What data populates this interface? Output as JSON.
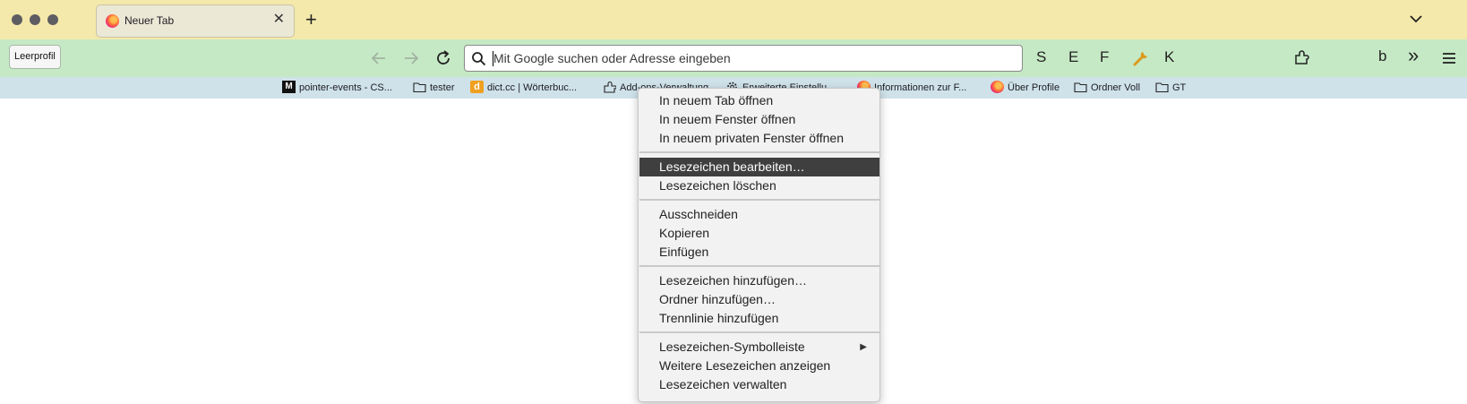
{
  "tab": {
    "title": "Neuer Tab",
    "close_symbol": "✕",
    "favicon": "firefox-logo-icon"
  },
  "titlebar": {
    "new_tab_symbol": "+",
    "tab_list_icon": "chevron-down-icon"
  },
  "toolbar": {
    "profile_label": "Leerprofil",
    "back_icon": "arrow-left-icon",
    "forward_icon": "arrow-right-icon",
    "reload_icon": "reload-icon",
    "url_placeholder": "Mit Google suchen oder Adresse eingeben",
    "letter_buttons": [
      "S",
      "E",
      "F",
      "K"
    ],
    "wrench_icon": "wrench-icon",
    "extension_icon": "puzzle-icon",
    "sidebar_letter": "b",
    "overflow_symbol": "»",
    "menu_icon": "hamburger-icon"
  },
  "bookmarks": [
    {
      "label": "pointer-events - CS...",
      "icon": "mdn-icon"
    },
    {
      "label": "tester",
      "icon": "folder-icon"
    },
    {
      "label": "dict.cc | Wörterbuc...",
      "icon": "dictcc-icon"
    },
    {
      "label": "Add-ons-Verwaltung",
      "icon": "puzzle-icon"
    },
    {
      "label": "Erweiterte Einstellu...",
      "icon": "gear-icon"
    },
    {
      "label": "Informationen zur F...",
      "icon": "firefox-logo-icon"
    },
    {
      "label": "Über Profile",
      "icon": "firefox-logo-icon"
    },
    {
      "label": "Ordner Voll",
      "icon": "folder-icon"
    },
    {
      "label": "GT",
      "icon": "folder-icon"
    }
  ],
  "context_menu": {
    "items": [
      "In neuem Tab öffnen",
      "In neuem Fenster öffnen",
      "In neuem privaten Fenster öffnen",
      "Lesezeichen bearbeiten…",
      "Lesezeichen löschen",
      "Ausschneiden",
      "Kopieren",
      "Einfügen",
      "Lesezeichen hinzufügen…",
      "Ordner hinzufügen…",
      "Trennlinie hinzufügen",
      "Lesezeichen-Symbolleiste",
      "Weitere Lesezeichen anzeigen",
      "Lesezeichen verwalten"
    ],
    "highlighted_item": "Lesezeichen bearbeiten…",
    "submenu_symbol": "▶"
  },
  "colors": {
    "titlebar": "#f4e9aa",
    "toolbar": "#c5e9c5",
    "bookmarks_bar": "#cfe2ea",
    "menu_highlight": "#3f3f3f"
  }
}
